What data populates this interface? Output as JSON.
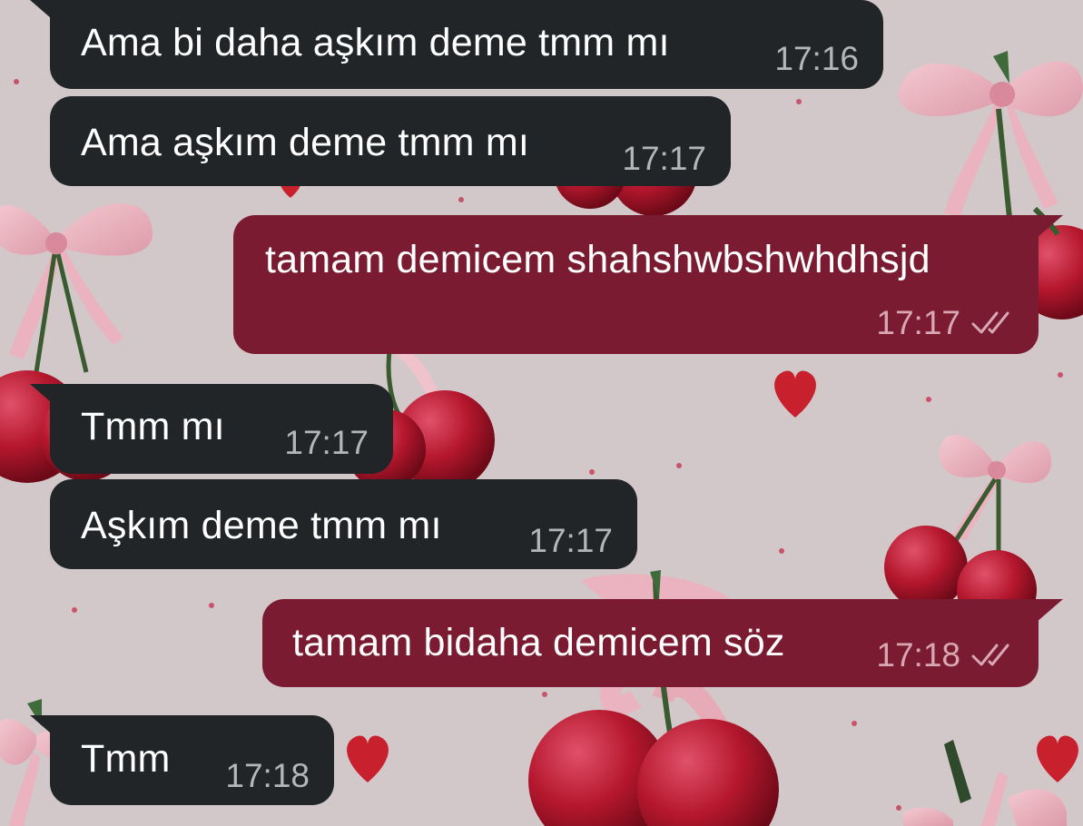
{
  "theme": {
    "wallpaper": "#d2c8c9",
    "incoming_bubble": "#212528",
    "outgoing_bubble": "#7a1b31"
  },
  "messages": [
    {
      "direction": "incoming",
      "text": "Ama bi daha aşkım deme tmm mı",
      "time": "17:16"
    },
    {
      "direction": "incoming",
      "text": "Ama aşkım deme tmm mı",
      "time": "17:17"
    },
    {
      "direction": "outgoing",
      "text": "tamam demicem shahshwbshwhdhsjd",
      "time": "17:17",
      "status": "read-checkmarks-icon"
    },
    {
      "direction": "incoming",
      "text": "Tmm mı",
      "time": "17:17"
    },
    {
      "direction": "incoming",
      "text": "Aşkım deme tmm mı",
      "time": "17:17"
    },
    {
      "direction": "outgoing",
      "text": "tamam bidaha demicem söz",
      "time": "17:18",
      "status": "read-checkmarks-icon"
    },
    {
      "direction": "incoming",
      "text": "Tmm",
      "time": "17:18"
    }
  ]
}
